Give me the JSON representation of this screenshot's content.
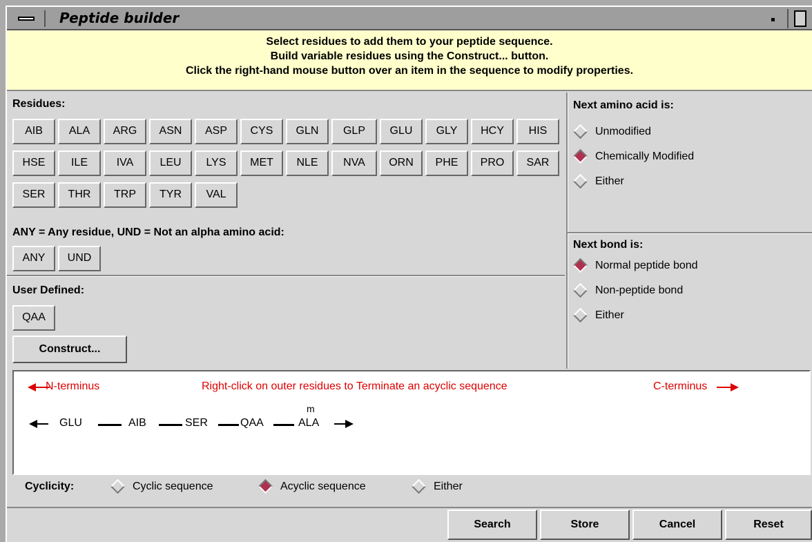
{
  "window": {
    "title": "Peptide builder"
  },
  "instructions": [
    "Select residues to add them to your peptide sequence.",
    "Build variable residues using the Construct... button.",
    "Click the right-hand mouse button over an item in the sequence to modify properties."
  ],
  "residues": {
    "title": "Residues:",
    "buttons": [
      "AIB",
      "ALA",
      "ARG",
      "ASN",
      "ASP",
      "CYS",
      "GLN",
      "GLP",
      "GLU",
      "GLY",
      "HCY",
      "HIS",
      "HSE",
      "ILE",
      "IVA",
      "LEU",
      "LYS",
      "MET",
      "NLE",
      "NVA",
      "ORN",
      "PHE",
      "PRO",
      "SAR",
      "SER",
      "THR",
      "TRP",
      "TYR",
      "VAL"
    ]
  },
  "special": {
    "title": "ANY = Any residue, UND = Not an alpha amino acid:",
    "buttons": [
      "ANY",
      "UND"
    ]
  },
  "user_defined": {
    "title": "User Defined:",
    "buttons": [
      "QAA"
    ],
    "construct_label": "Construct..."
  },
  "next_amino_acid": {
    "title": "Next amino acid is:",
    "options": [
      {
        "label": "Unmodified",
        "selected": false
      },
      {
        "label": "Chemically Modified",
        "selected": true
      },
      {
        "label": "Either",
        "selected": false
      }
    ]
  },
  "next_bond": {
    "title": "Next bond is:",
    "options": [
      {
        "label": "Normal peptide bond",
        "selected": true
      },
      {
        "label": "Non-peptide bond",
        "selected": false
      },
      {
        "label": "Either",
        "selected": false
      }
    ]
  },
  "sequence": {
    "n_terminus": "N-terminus",
    "hint": "Right-click on outer residues to Terminate an acyclic sequence",
    "c_terminus": "C-terminus",
    "items": [
      "GLU",
      "AIB",
      "SER",
      "QAA",
      "ALA"
    ],
    "modifier": "m"
  },
  "cyclicity": {
    "label": "Cyclicity:",
    "options": [
      {
        "label": "Cyclic sequence",
        "selected": false
      },
      {
        "label": "Acyclic sequence",
        "selected": true
      },
      {
        "label": "Either",
        "selected": false
      }
    ]
  },
  "actions": {
    "search": "Search",
    "store": "Store",
    "cancel": "Cancel",
    "reset": "Reset"
  },
  "colors": {
    "instruction_bg": "#ffffcc",
    "selected_radio": "#b03050",
    "hint_text": "#dd0000"
  }
}
